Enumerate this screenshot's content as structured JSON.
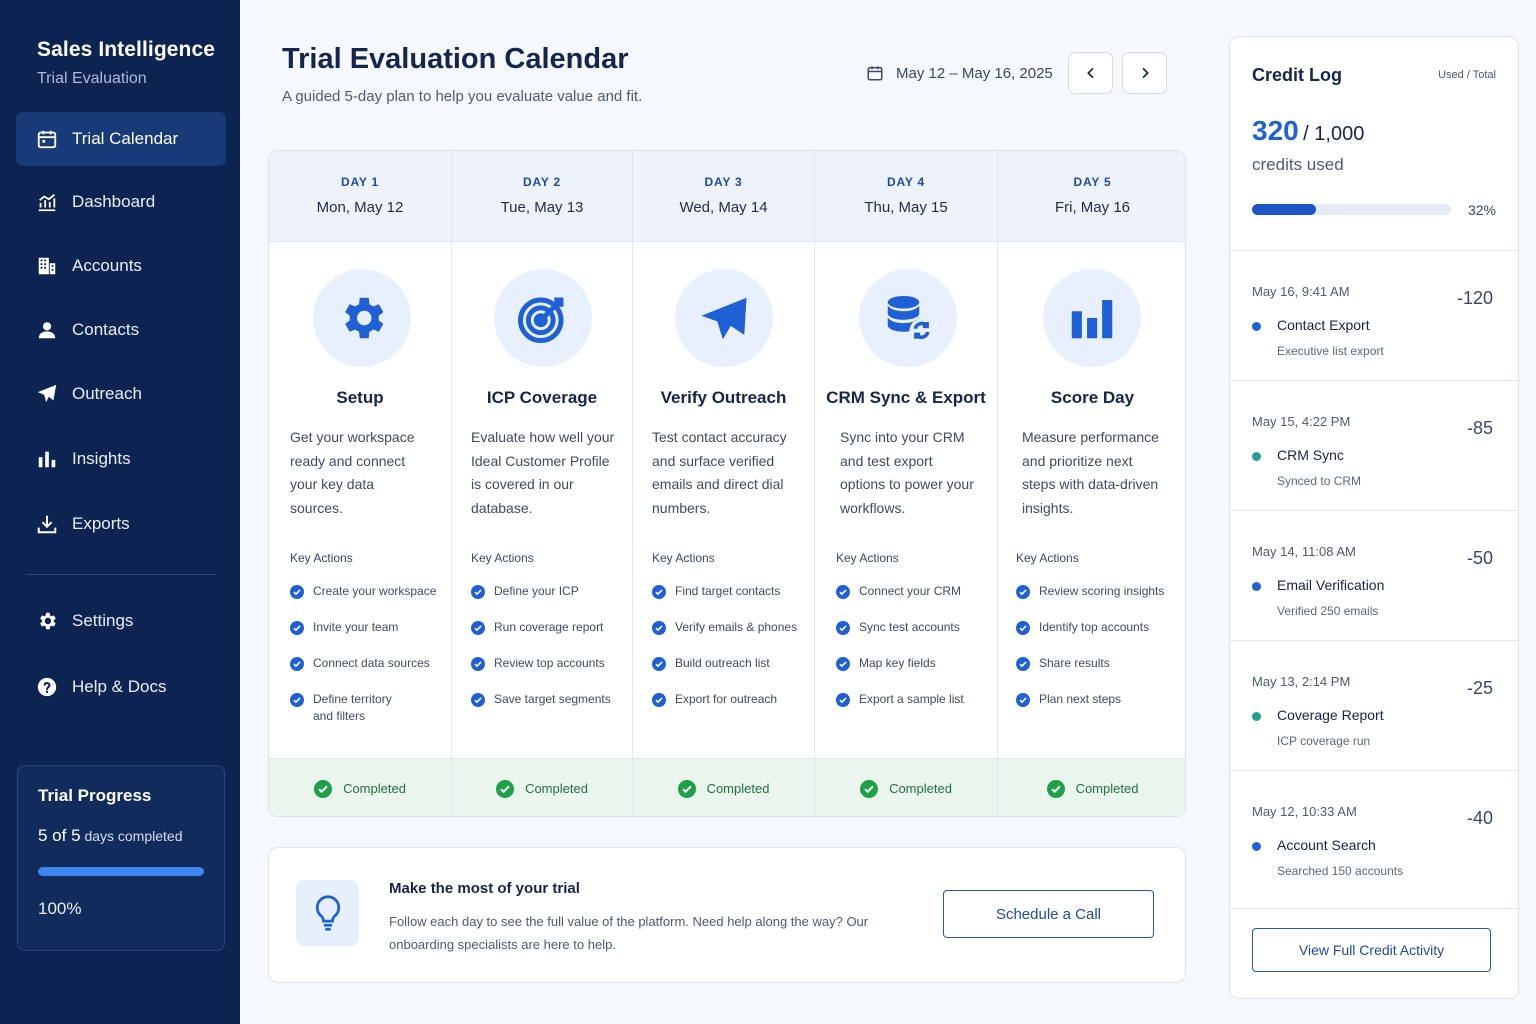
{
  "sidebar": {
    "brand_title": "Sales Intelligence",
    "brand_subtitle": "Trial Evaluation",
    "nav": [
      {
        "label": "Trial Calendar",
        "icon": "calendar-icon",
        "active": true
      },
      {
        "label": "Dashboard",
        "icon": "chart-icon"
      },
      {
        "label": "Accounts",
        "icon": "building-icon"
      },
      {
        "label": "Contacts",
        "icon": "user-icon"
      },
      {
        "label": "Outreach",
        "icon": "paper-plane-icon"
      },
      {
        "label": "Insights",
        "icon": "bar-chart-icon"
      },
      {
        "label": "Exports",
        "icon": "download-icon"
      },
      {
        "label": "Settings",
        "icon": "gear-icon"
      },
      {
        "label": "Help & Docs",
        "icon": "help-icon"
      }
    ],
    "trial": {
      "title": "Trial Progress",
      "days_done": "5 of 5",
      "days_suffix": "days completed",
      "percent_label": "100%",
      "progress": 1.0
    }
  },
  "header": {
    "title": "Trial Evaluation Calendar",
    "subtitle": "A guided 5-day plan to help you evaluate value and fit.",
    "date_range": "May 12 – May 16, 2025"
  },
  "calendar": {
    "key_actions_label": "Key Actions",
    "days": [
      {
        "day": "DAY 1",
        "date": "Mon, May 12",
        "icon": "gear-icon",
        "title": "Setup",
        "desc": "Get your workspace ready and connect your key data sources.",
        "actions": [
          "Create your workspace",
          "Invite your team",
          "Connect data sources",
          "Define territory and filters"
        ],
        "status": "Completed"
      },
      {
        "day": "DAY 2",
        "date": "Tue, May 13",
        "icon": "target-icon",
        "title": "ICP Coverage",
        "desc": "Evaluate how well your Ideal Customer Profile is covered in our database.",
        "actions": [
          "Define your ICP",
          "Run coverage report",
          "Review top accounts",
          "Save target segments"
        ],
        "status": "Completed"
      },
      {
        "day": "DAY 3",
        "date": "Wed, May 14",
        "icon": "paper-plane-icon",
        "title": "Verify Outreach",
        "desc": "Test contact accuracy and surface verified emails and direct dial numbers.",
        "actions": [
          "Find target contacts",
          "Verify emails & phones",
          "Build outreach list",
          "Export for outreach"
        ],
        "status": "Completed"
      },
      {
        "day": "DAY 4",
        "date": "Thu, May 15",
        "icon": "database-sync-icon",
        "title": "CRM Sync & Export",
        "desc": "Sync into your CRM and test export options to power your workflows.",
        "actions": [
          "Connect your CRM",
          "Sync test accounts",
          "Map key fields",
          "Export a sample list"
        ],
        "status": "Completed"
      },
      {
        "day": "DAY 5",
        "date": "Fri, May 16",
        "icon": "bar-chart-icon",
        "title": "Score Day",
        "desc": "Measure performance and prioritize next steps with data-driven insights.",
        "actions": [
          "Review scoring insights",
          "Identify top accounts",
          "Share results",
          "Plan next steps"
        ],
        "status": "Completed"
      }
    ]
  },
  "tip": {
    "title": "Make the most of your trial",
    "text": "Follow each day to see the full value of the platform. Need help along the way? Our onboarding specialists are here to help.",
    "button": "Schedule a Call"
  },
  "credit_log": {
    "title": "Credit Log",
    "hint": "Used / Total",
    "used": "320",
    "total": "/ 1,000",
    "caption": "credits used",
    "percent_label": "32%",
    "progress": 0.32,
    "entries": [
      {
        "time": "May 16, 9:41 AM",
        "delta": "-120",
        "name": "Contact Export",
        "sub": "Executive list export",
        "dot": "#1e62d8"
      },
      {
        "time": "May 15, 4:22 PM",
        "delta": "-85",
        "name": "CRM Sync",
        "sub": "Synced to CRM",
        "dot": "#23a08f"
      },
      {
        "time": "May 14, 11:08 AM",
        "delta": "-50",
        "name": "Email Verification",
        "sub": "Verified 250 emails",
        "dot": "#1e62d8"
      },
      {
        "time": "May 13, 2:14 PM",
        "delta": "-25",
        "name": "Coverage Report",
        "sub": "ICP coverage run",
        "dot": "#23a08f"
      },
      {
        "time": "May 12, 10:33 AM",
        "delta": "-40",
        "name": "Account Search",
        "sub": "Searched 150 accounts",
        "dot": "#1e62d8"
      }
    ],
    "button": "View Full Credit Activity"
  },
  "colors": {
    "sidebar_bg": "#0d2452",
    "accent": "#1e62d8",
    "success": "#21a04a"
  }
}
